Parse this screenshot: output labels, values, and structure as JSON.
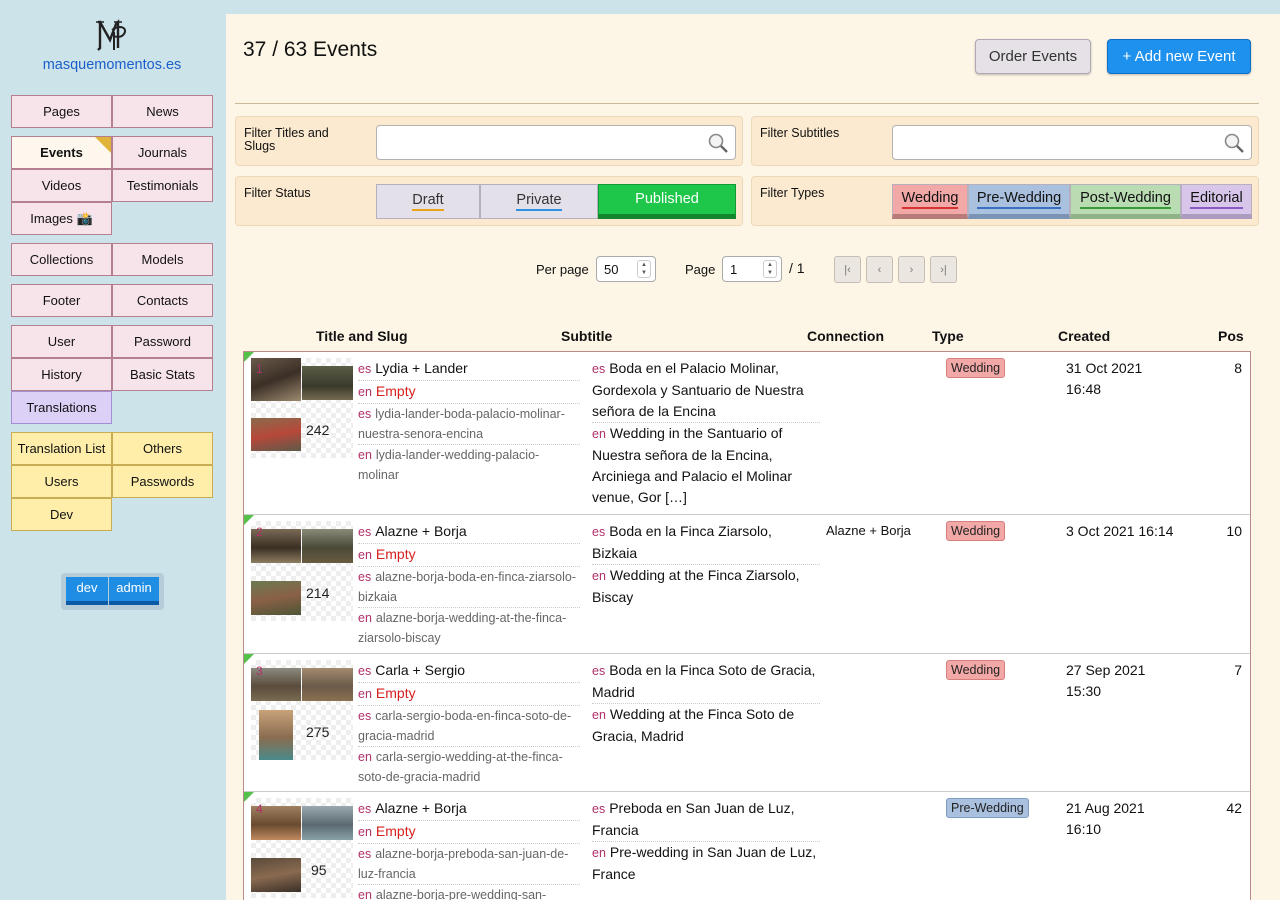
{
  "site": {
    "name": "masquemomentos.es"
  },
  "nav": {
    "pages": "Pages",
    "news": "News",
    "events": "Events",
    "journals": "Journals",
    "videos": "Videos",
    "testimonials": "Testimonials",
    "images": "Images 📸",
    "collections": "Collections",
    "models": "Models",
    "footer": "Footer",
    "contacts": "Contacts",
    "user": "User",
    "password": "Password",
    "history": "History",
    "basic_stats": "Basic Stats",
    "translations": "Translations",
    "translation_list": "Translation List",
    "others": "Others",
    "users": "Users",
    "passwords": "Passwords",
    "dev": "Dev"
  },
  "env": {
    "dev": "dev",
    "admin": "admin"
  },
  "header": {
    "title": "37 / 63 Events",
    "order_button": "Order Events",
    "add_button": "+ Add new Event"
  },
  "filters": {
    "titles_label": "Filter Titles and Slugs",
    "titles_value": "",
    "subtitles_label": "Filter Subtitles",
    "subtitles_value": "",
    "status_label": "Filter Status",
    "status": [
      {
        "label": "Draft",
        "color": "#e8a51a"
      },
      {
        "label": "Private",
        "color": "#2f8fe0"
      },
      {
        "label": "Published",
        "color": "#1ec64a"
      }
    ],
    "types_label": "Filter Types",
    "types": [
      {
        "label": "Wedding",
        "color": "#f2a8a6",
        "line": "#d63232"
      },
      {
        "label": "Pre-Wedding",
        "color": "#a9c0de",
        "line": "#3a6fc4"
      },
      {
        "label": "Post-Wedding",
        "color": "#b9dcb2",
        "line": "#3a9a3a"
      },
      {
        "label": "Editorial",
        "color": "#d7c6ea",
        "line": "#8a5ac4"
      }
    ]
  },
  "pagination": {
    "per_page_label": "Per page",
    "per_page": "50",
    "page_label": "Page",
    "page": "1",
    "total": "/ 1"
  },
  "table": {
    "columns": [
      "Title and Slug",
      "Subtitle",
      "Connection",
      "Type",
      "Created",
      "Pos"
    ],
    "rows": [
      {
        "num": "1",
        "count": "242",
        "title_es": "Lydia + Lander",
        "title_en": "Empty",
        "slug_es": "lydia-lander-boda-palacio-molinar-nuestra-senora-encina",
        "slug_en": "lydia-lander-wedding-palacio-molinar",
        "sub_es": "Boda en el Palacio Molinar, Gordexola y Santuario de Nuestra señora de la Encina",
        "sub_en": "Wedding in the Santuario of Nuestra señora de la Encina, Arciniega and Palacio el Molinar venue, Gor […]",
        "connection": "",
        "type": "Wedding",
        "created": "31 Oct 2021 16:48",
        "pos": "8"
      },
      {
        "num": "2",
        "count": "214",
        "title_es": "Alazne + Borja",
        "title_en": "Empty",
        "slug_es": "alazne-borja-boda-en-finca-ziarsolo-bizkaia",
        "slug_en": "alazne-borja-wedding-at-the-finca-ziarsolo-biscay",
        "sub_es": "Boda en la Finca Ziarsolo, Bizkaia",
        "sub_en": "Wedding at the Finca Ziarsolo, Biscay",
        "connection": "Alazne + Borja",
        "type": "Wedding",
        "created": "3 Oct 2021 16:14",
        "pos": "10"
      },
      {
        "num": "3",
        "count": "275",
        "title_es": "Carla + Sergio",
        "title_en": "Empty",
        "slug_es": "carla-sergio-boda-en-finca-soto-de-gracia-madrid",
        "slug_en": "carla-sergio-wedding-at-the-finca-soto-de-gracia-madrid",
        "sub_es": "Boda en la Finca Soto de Gracia, Madrid",
        "sub_en": "Wedding at the Finca Soto de Gracia, Madrid",
        "connection": "",
        "type": "Wedding",
        "created": "27 Sep 2021 15:30",
        "pos": "7"
      },
      {
        "num": "4",
        "count": "95",
        "title_es": "Alazne + Borja",
        "title_en": "Empty",
        "slug_es": "alazne-borja-preboda-san-juan-de-luz-francia",
        "slug_en": "alazne-borja-pre-wedding-san-",
        "sub_es": "Preboda en San Juan de Luz, Francia",
        "sub_en": "Pre-wedding in San Juan de Luz, France",
        "connection": "",
        "type": "Pre-Wedding",
        "created": "21 Aug 2021 16:10",
        "pos": "42"
      }
    ]
  },
  "lang": {
    "es": "es",
    "en": "en"
  }
}
